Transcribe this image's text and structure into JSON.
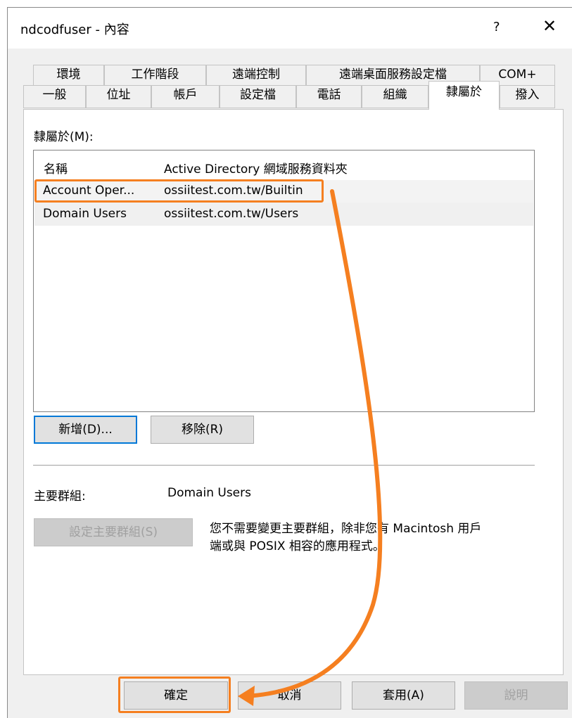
{
  "window": {
    "title": "ndcodfuser - 內容",
    "help_label": "?",
    "close_label": "✕"
  },
  "tabs_row1": [
    "環境",
    "工作階段",
    "遠端控制",
    "遠端桌面服務設定檔",
    "COM+"
  ],
  "tabs_row2": [
    "一般",
    "位址",
    "帳戶",
    "設定檔",
    "電話",
    "組織",
    "隸屬於",
    "撥入"
  ],
  "member_of": {
    "label": "隸屬於(M):",
    "columns": [
      "名稱",
      "Active Directory 網域服務資料夾"
    ],
    "rows": [
      {
        "name": "Account Oper...",
        "folder": "ossiitest.com.tw/Builtin"
      },
      {
        "name": "Domain Users",
        "folder": "ossiitest.com.tw/Users"
      }
    ],
    "add_button": "新增(D)...",
    "remove_button": "移除(R)"
  },
  "primary_group": {
    "label": "主要群組:",
    "value": "Domain Users",
    "set_button": "設定主要群組(S)",
    "note_line1": "您不需要變更主要群組，除非您有 Macintosh 用戶",
    "note_line2": "端或與 POSIX 相容的應用程式。"
  },
  "footer": {
    "ok": "確定",
    "cancel": "取消",
    "apply": "套用(A)",
    "help": "說明"
  },
  "colors": {
    "annotation": "#f57f20",
    "focus": "#0078d7"
  }
}
